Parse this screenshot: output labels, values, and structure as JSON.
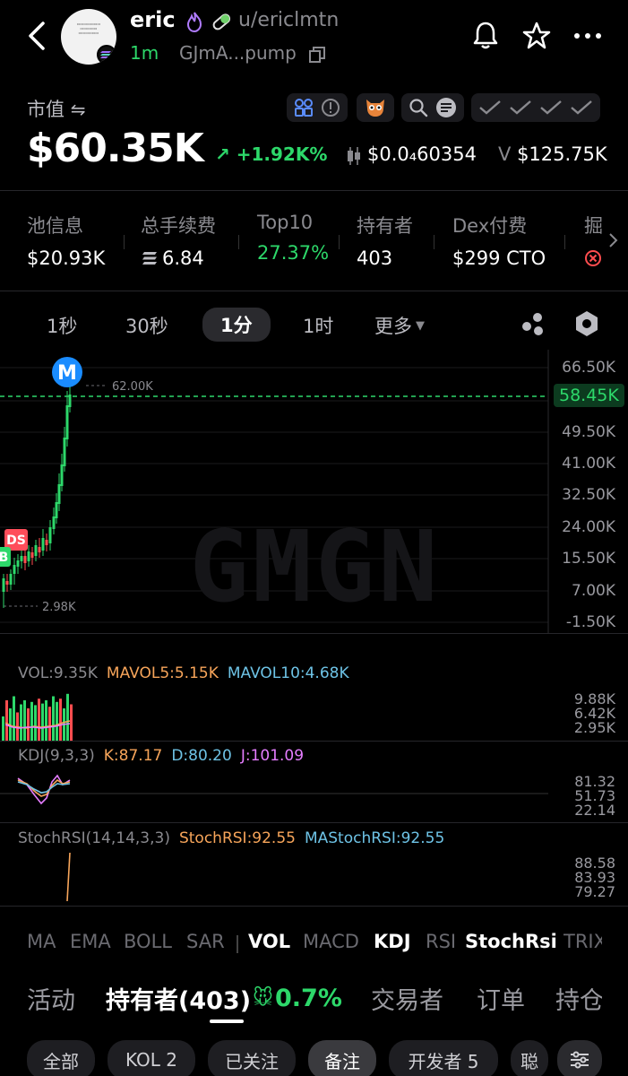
{
  "header": {
    "token_name": "eric",
    "handle": "u/ericlmtn",
    "age": "1m",
    "contract_short": "GJmA...pump"
  },
  "market": {
    "label": "市值",
    "value": "$60.35K",
    "change": "+1.92K%",
    "price": "$0.0₄60354",
    "volume_prefix": "V",
    "volume": "$125.75K"
  },
  "stats": [
    {
      "label": "池信息",
      "value": "$20.93K"
    },
    {
      "label": "总手续费",
      "value": "6.84"
    },
    {
      "label": "Top10",
      "value": "27.37%"
    },
    {
      "label": "持有者",
      "value": "403"
    },
    {
      "label": "Dex付费",
      "value": "$299 CTO"
    },
    {
      "label": "掘"
    }
  ],
  "intervals": {
    "items": [
      "1秒",
      "30秒",
      "1分",
      "1时",
      "更多"
    ],
    "active": "1分"
  },
  "chart": {
    "watermark": "GMGN",
    "marker_letter": "M",
    "high_label": "62.00K",
    "low_label": "2.98K",
    "current_price_label": "58.45K",
    "badges": [
      "DS",
      "B"
    ],
    "price_axis": [
      "66.50K",
      "58.45K",
      "49.50K",
      "41.00K",
      "32.50K",
      "24.00K",
      "15.50K",
      "7.00K",
      "-1.50K"
    ],
    "colors": {
      "up": "#2dd86a",
      "down": "#ff4d4f",
      "dashed": "#2dd86a"
    }
  },
  "volume": {
    "vol": "VOL:9.35K",
    "mavol5": "MAVOL5:5.15K",
    "mavol10": "MAVOL10:4.68K",
    "axis": [
      "9.88K",
      "6.42K",
      "2.95K"
    ]
  },
  "kdj": {
    "title": "KDJ(9,3,3)",
    "k": "K:87.17",
    "d": "D:80.20",
    "j": "J:101.09",
    "axis": [
      "81.32",
      "51.73",
      "22.14"
    ]
  },
  "stochrsi": {
    "title": "StochRSI(14,14,3,3)",
    "value": "StochRSI:92.55",
    "ma": "MAStochRSI:92.55",
    "axis": [
      "88.58",
      "83.93",
      "79.27"
    ]
  },
  "indicator_tabs": [
    {
      "label": "MA",
      "on": false
    },
    {
      "label": "EMA",
      "on": false
    },
    {
      "label": "BOLL",
      "on": false
    },
    {
      "label": "SAR",
      "on": false
    },
    {
      "label": "VOL",
      "on": true
    },
    {
      "label": "MACD",
      "on": false
    },
    {
      "label": "KDJ",
      "on": true
    },
    {
      "label": "RSI",
      "on": false
    },
    {
      "label": "StochRsi",
      "on": true
    },
    {
      "label": "TRIX",
      "on": false
    }
  ],
  "bottom_tabs": {
    "activity": "活动",
    "holders": "持有者(403)",
    "holder_pct": "0.7%",
    "traders": "交易者",
    "orders": "订单",
    "positions": "持仓"
  },
  "filters": [
    "全部",
    "KOL 2",
    "已关注",
    "备注",
    "开发者 5",
    "聪"
  ]
}
